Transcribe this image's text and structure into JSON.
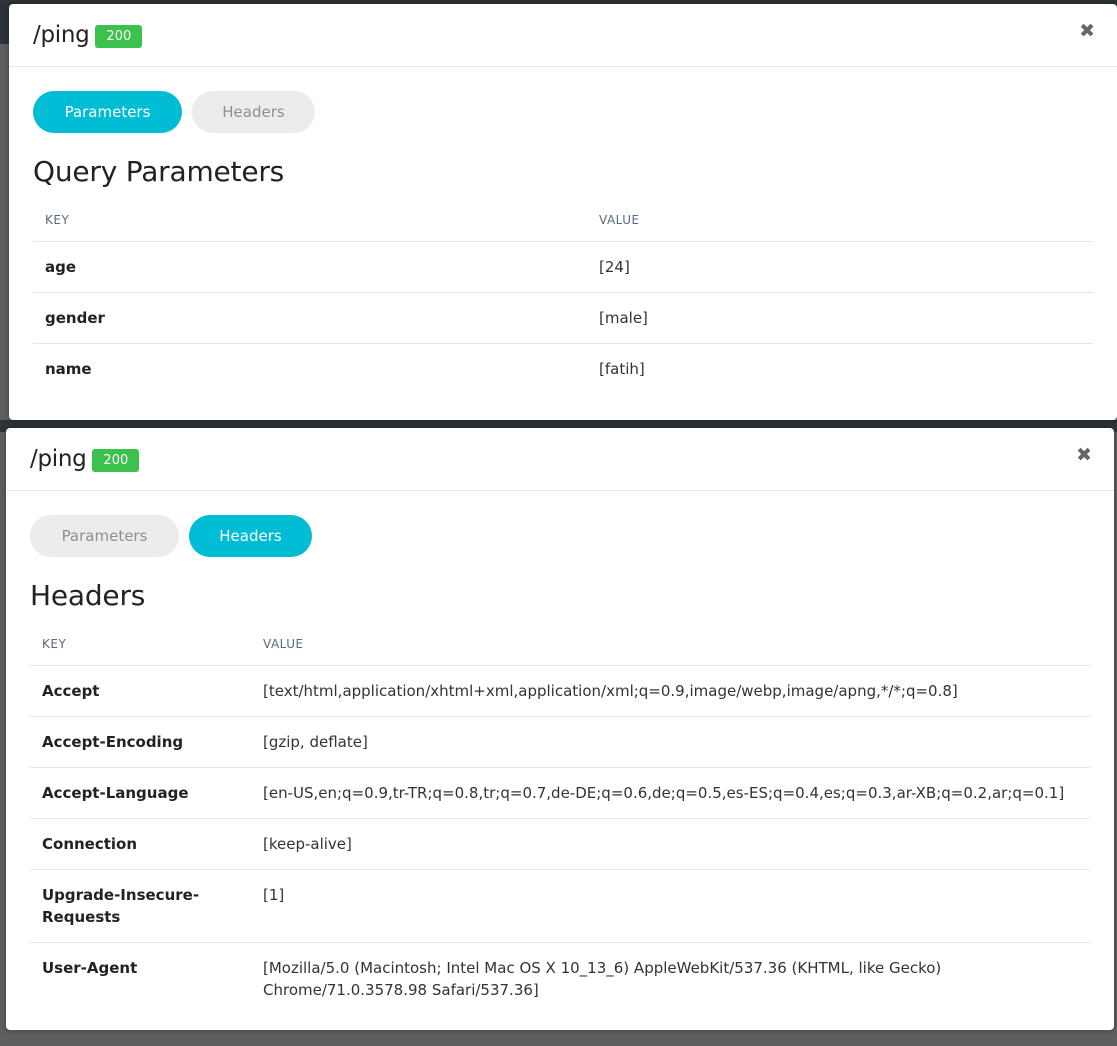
{
  "modal_params": {
    "endpoint": "/ping",
    "status": "200",
    "close_icon": "✖",
    "tabs": {
      "parameters": "Parameters",
      "headers": "Headers"
    },
    "section_title": "Query Parameters",
    "columns": {
      "key": "KEY",
      "value": "VALUE"
    },
    "rows": [
      {
        "key": "age",
        "value": "[24]"
      },
      {
        "key": "gender",
        "value": "[male]"
      },
      {
        "key": "name",
        "value": "[fatih]"
      }
    ]
  },
  "modal_headers": {
    "endpoint": "/ping",
    "status": "200",
    "close_icon": "✖",
    "tabs": {
      "parameters": "Parameters",
      "headers": "Headers"
    },
    "section_title": "Headers",
    "columns": {
      "key": "KEY",
      "value": "VALUE"
    },
    "rows": [
      {
        "key": "Accept",
        "value": "[text/html,application/xhtml+xml,application/xml;q=0.9,image/webp,image/apng,*/*;q=0.8]"
      },
      {
        "key": "Accept-Encoding",
        "value": "[gzip, deflate]"
      },
      {
        "key": "Accept-Language",
        "value": "[en-US,en;q=0.9,tr-TR;q=0.8,tr;q=0.7,de-DE;q=0.6,de;q=0.5,es-ES;q=0.4,es;q=0.3,ar-XB;q=0.2,ar;q=0.1]"
      },
      {
        "key": "Connection",
        "value": "[keep-alive]"
      },
      {
        "key": "Upgrade-Insecure-Requests",
        "value": "[1]"
      },
      {
        "key": "User-Agent",
        "value": "[Mozilla/5.0 (Macintosh; Intel Mac OS X 10_13_6) AppleWebKit/537.36 (KHTML, like Gecko) Chrome/71.0.3578.98 Safari/537.36]"
      }
    ]
  },
  "colors": {
    "accent": "#00bcd4",
    "status_ok": "#3cc04e",
    "inactive_tab": "#ececec"
  }
}
